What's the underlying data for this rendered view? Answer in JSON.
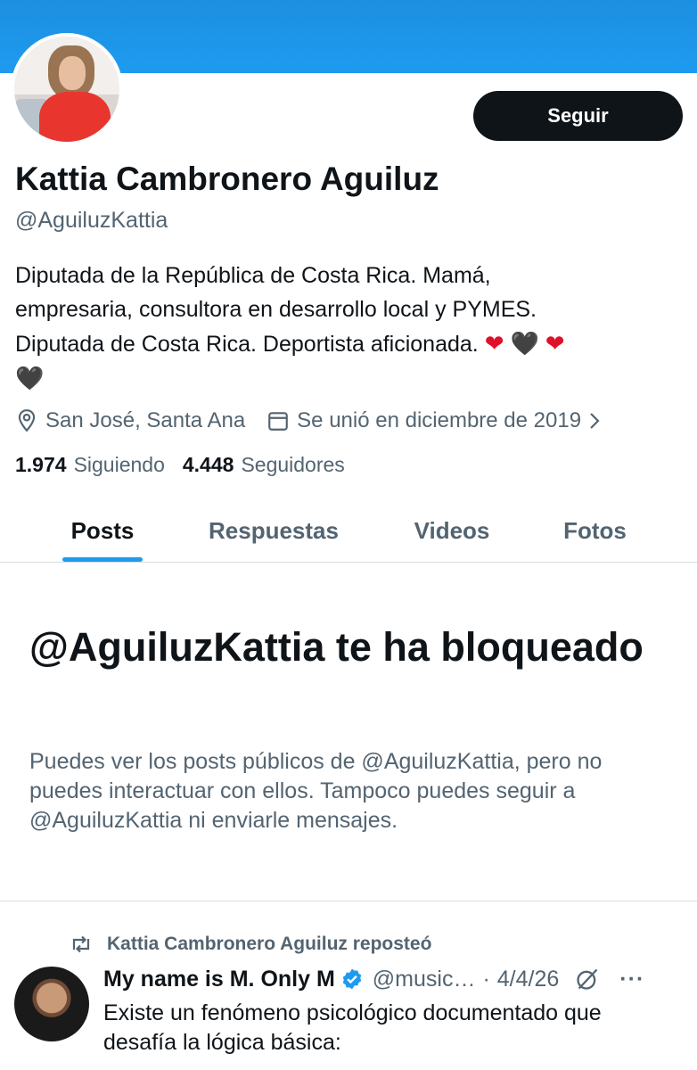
{
  "profile": {
    "follow_label": "Seguir",
    "name": "Kattia Cambronero Aguiluz",
    "handle": "@AguiluzKattia",
    "bio_line1": "Diputada de la República de Costa Rica. Mamá,",
    "bio_line2": "empresaria, consultora en desarrollo local y PYMES.",
    "bio_line3": "Diputada de Costa Rica. Deportista aficionada.",
    "bio_emojis": [
      "❤",
      "🖤",
      "❤",
      "🖤"
    ],
    "location": "San José, Santa Ana",
    "joined": "Se unió en diciembre de 2019",
    "following_count": "1.974",
    "following_label": "Siguiendo",
    "followers_count": "4.448",
    "followers_label": "Seguidores"
  },
  "tabs": [
    {
      "label": "Posts",
      "active": true
    },
    {
      "label": "Respuestas",
      "active": false
    },
    {
      "label": "Videos",
      "active": false
    },
    {
      "label": "Fotos",
      "active": false
    }
  ],
  "blocked": {
    "title": "@AguiluzKattia te ha bloqueado",
    "description": "Puedes ver los posts públicos de @AguiluzKattia, pero no puedes interactuar con ellos. Tampoco puedes seguir a @AguiluzKattia ni enviarle mensajes."
  },
  "post": {
    "repost_text": "Kattia Cambronero Aguiluz reposteó",
    "author": "My name is M. Only M",
    "handle": "@music…",
    "separator": "·",
    "date": "4/4/26",
    "more": "···",
    "text_line1": "Existe un fenómeno psicológico documentado que",
    "text_line2": "desafía la lógica básica:"
  },
  "colors": {
    "accent": "#1d9bf0",
    "text": "#0f1419",
    "muted": "#536471",
    "heart_red": "#e0102a"
  },
  "icons": {
    "location": "location-pin-icon",
    "calendar": "calendar-icon",
    "chevron": "chevron-right-icon",
    "repost": "repost-icon",
    "verified": "verified-badge-icon",
    "grok": "grok-icon",
    "more": "more-icon"
  }
}
